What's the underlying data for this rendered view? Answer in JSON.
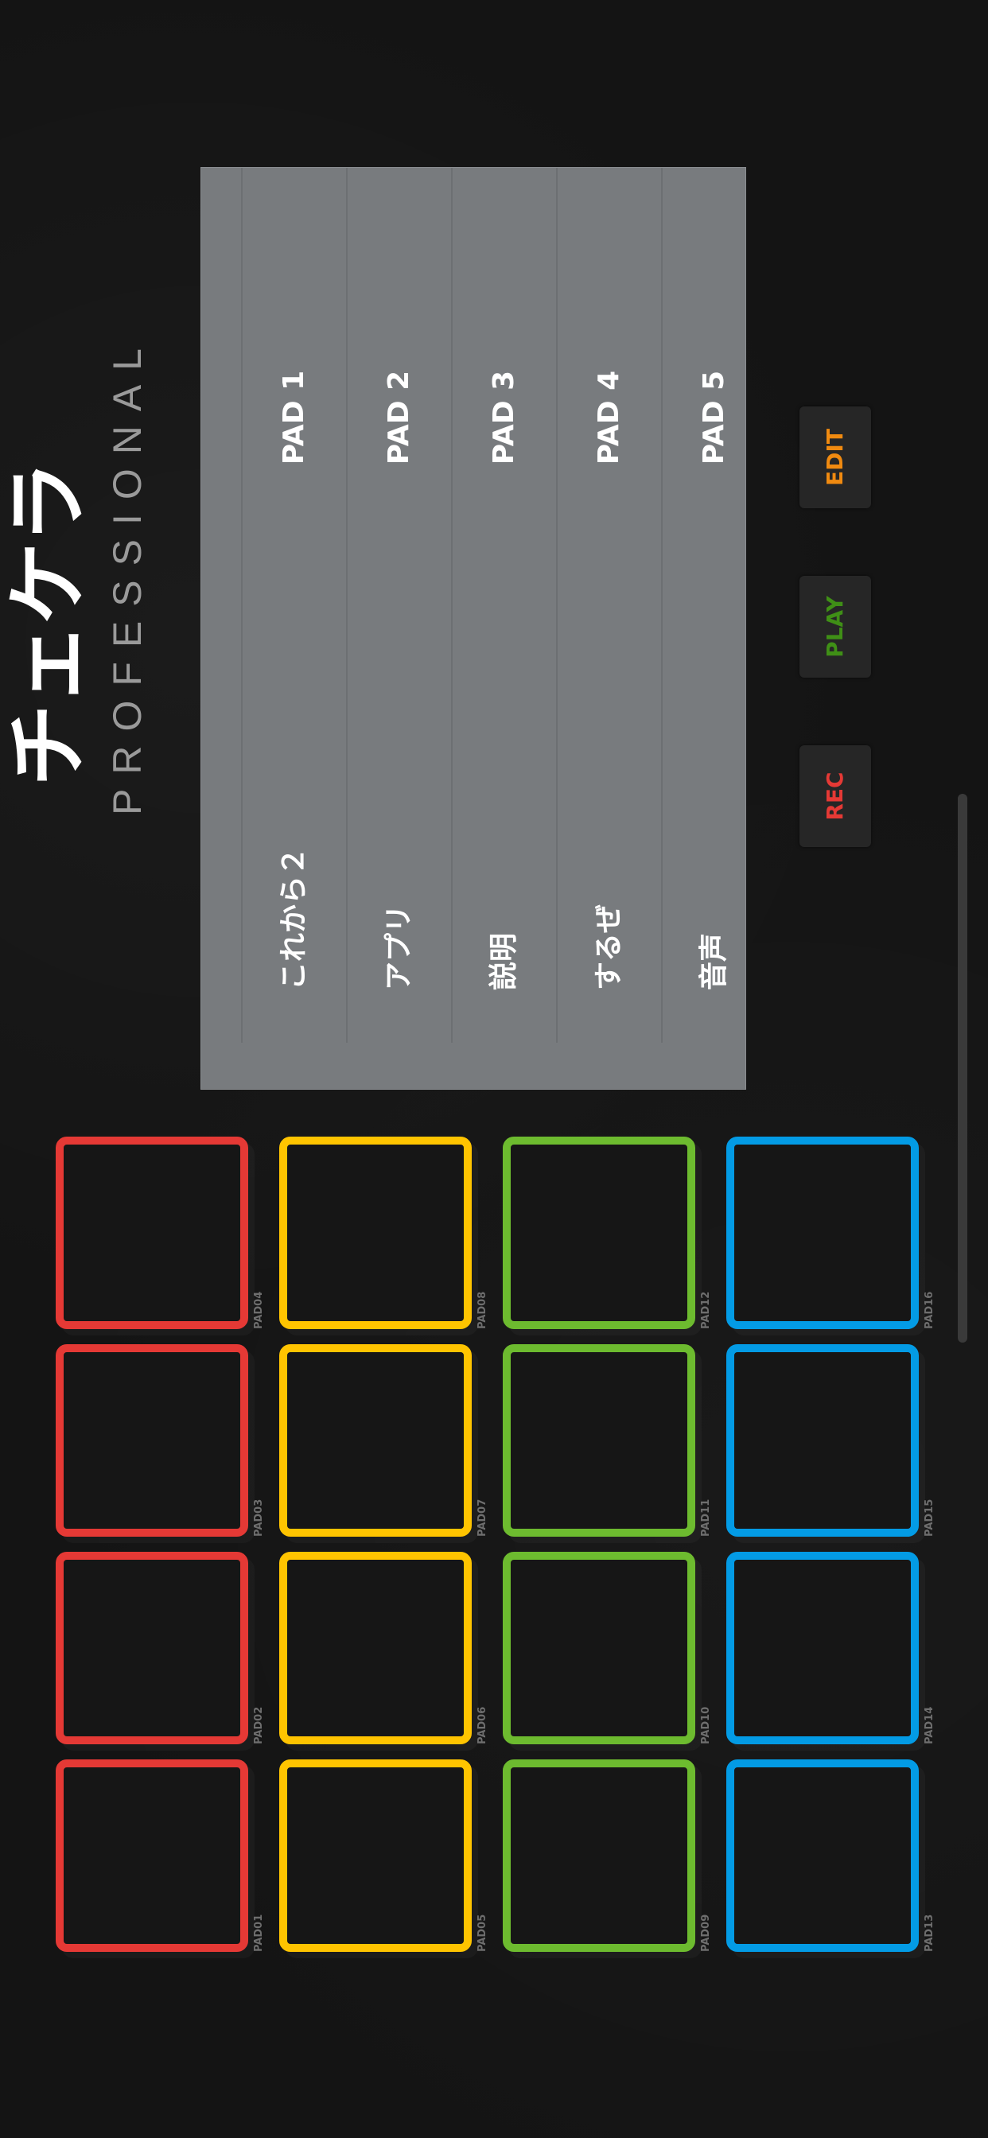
{
  "logo": {
    "title": "チェケラ",
    "subtitle": "PROFESSIONAL"
  },
  "pad_list": [
    {
      "name": "これから２",
      "label": "PAD 1"
    },
    {
      "name": "アプリ",
      "label": "PAD 2"
    },
    {
      "name": "説明",
      "label": "PAD 3"
    },
    {
      "name": "するぜ",
      "label": "PAD 4"
    },
    {
      "name": "音声",
      "label": "PAD 5"
    }
  ],
  "buttons": {
    "rec": "REC",
    "play": "PLAY",
    "edit": "EDIT"
  },
  "pads": {
    "labels": [
      "PAD01",
      "PAD02",
      "PAD03",
      "PAD04",
      "PAD05",
      "PAD06",
      "PAD07",
      "PAD08",
      "PAD09",
      "PAD10",
      "PAD11",
      "PAD12",
      "PAD13",
      "PAD14",
      "PAD15",
      "PAD16"
    ]
  },
  "colors": {
    "red": "#e53935",
    "yellow": "#ffc400",
    "green": "#6dbb2f",
    "blue": "#039be5",
    "rec": "#e53935",
    "play": "#3f8f16",
    "edit": "#f08a10"
  }
}
